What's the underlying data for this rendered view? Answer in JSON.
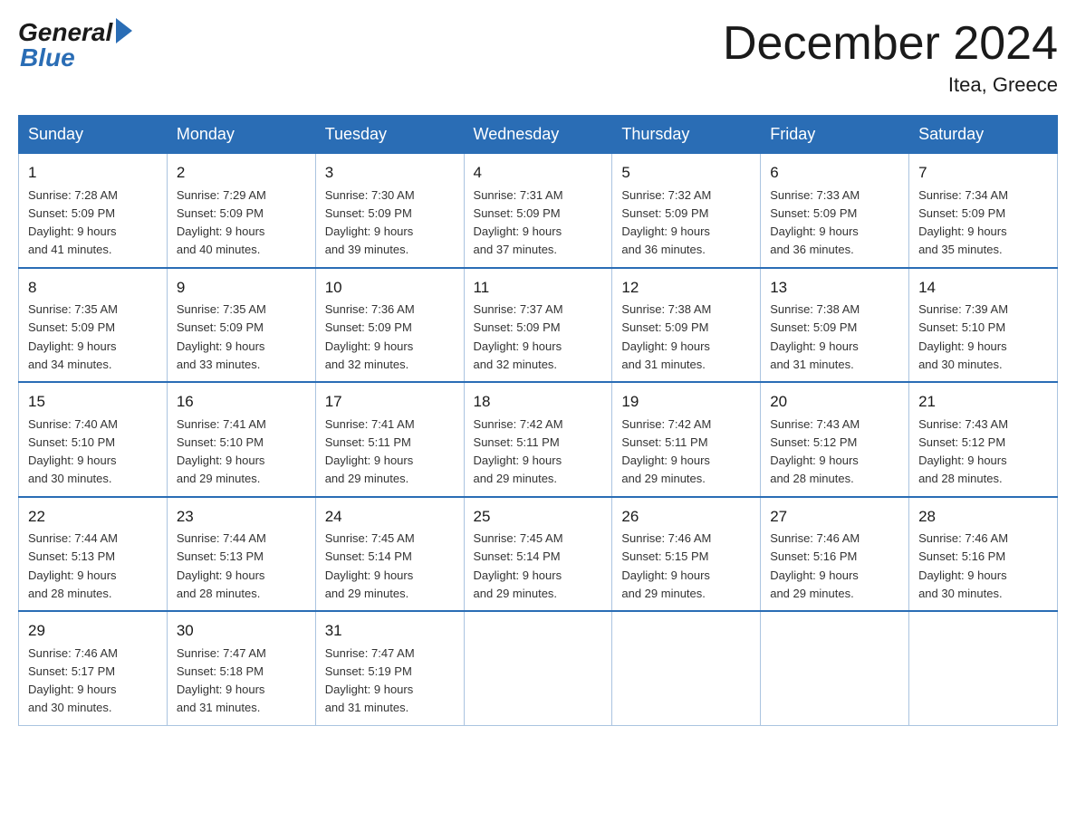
{
  "logo": {
    "general": "General",
    "blue": "Blue"
  },
  "title": "December 2024",
  "location": "Itea, Greece",
  "days_of_week": [
    "Sunday",
    "Monday",
    "Tuesday",
    "Wednesday",
    "Thursday",
    "Friday",
    "Saturday"
  ],
  "weeks": [
    [
      {
        "day": "1",
        "sunrise": "7:28 AM",
        "sunset": "5:09 PM",
        "daylight": "9 hours and 41 minutes."
      },
      {
        "day": "2",
        "sunrise": "7:29 AM",
        "sunset": "5:09 PM",
        "daylight": "9 hours and 40 minutes."
      },
      {
        "day": "3",
        "sunrise": "7:30 AM",
        "sunset": "5:09 PM",
        "daylight": "9 hours and 39 minutes."
      },
      {
        "day": "4",
        "sunrise": "7:31 AM",
        "sunset": "5:09 PM",
        "daylight": "9 hours and 37 minutes."
      },
      {
        "day": "5",
        "sunrise": "7:32 AM",
        "sunset": "5:09 PM",
        "daylight": "9 hours and 36 minutes."
      },
      {
        "day": "6",
        "sunrise": "7:33 AM",
        "sunset": "5:09 PM",
        "daylight": "9 hours and 36 minutes."
      },
      {
        "day": "7",
        "sunrise": "7:34 AM",
        "sunset": "5:09 PM",
        "daylight": "9 hours and 35 minutes."
      }
    ],
    [
      {
        "day": "8",
        "sunrise": "7:35 AM",
        "sunset": "5:09 PM",
        "daylight": "9 hours and 34 minutes."
      },
      {
        "day": "9",
        "sunrise": "7:35 AM",
        "sunset": "5:09 PM",
        "daylight": "9 hours and 33 minutes."
      },
      {
        "day": "10",
        "sunrise": "7:36 AM",
        "sunset": "5:09 PM",
        "daylight": "9 hours and 32 minutes."
      },
      {
        "day": "11",
        "sunrise": "7:37 AM",
        "sunset": "5:09 PM",
        "daylight": "9 hours and 32 minutes."
      },
      {
        "day": "12",
        "sunrise": "7:38 AM",
        "sunset": "5:09 PM",
        "daylight": "9 hours and 31 minutes."
      },
      {
        "day": "13",
        "sunrise": "7:38 AM",
        "sunset": "5:09 PM",
        "daylight": "9 hours and 31 minutes."
      },
      {
        "day": "14",
        "sunrise": "7:39 AM",
        "sunset": "5:10 PM",
        "daylight": "9 hours and 30 minutes."
      }
    ],
    [
      {
        "day": "15",
        "sunrise": "7:40 AM",
        "sunset": "5:10 PM",
        "daylight": "9 hours and 30 minutes."
      },
      {
        "day": "16",
        "sunrise": "7:41 AM",
        "sunset": "5:10 PM",
        "daylight": "9 hours and 29 minutes."
      },
      {
        "day": "17",
        "sunrise": "7:41 AM",
        "sunset": "5:11 PM",
        "daylight": "9 hours and 29 minutes."
      },
      {
        "day": "18",
        "sunrise": "7:42 AM",
        "sunset": "5:11 PM",
        "daylight": "9 hours and 29 minutes."
      },
      {
        "day": "19",
        "sunrise": "7:42 AM",
        "sunset": "5:11 PM",
        "daylight": "9 hours and 29 minutes."
      },
      {
        "day": "20",
        "sunrise": "7:43 AM",
        "sunset": "5:12 PM",
        "daylight": "9 hours and 28 minutes."
      },
      {
        "day": "21",
        "sunrise": "7:43 AM",
        "sunset": "5:12 PM",
        "daylight": "9 hours and 28 minutes."
      }
    ],
    [
      {
        "day": "22",
        "sunrise": "7:44 AM",
        "sunset": "5:13 PM",
        "daylight": "9 hours and 28 minutes."
      },
      {
        "day": "23",
        "sunrise": "7:44 AM",
        "sunset": "5:13 PM",
        "daylight": "9 hours and 28 minutes."
      },
      {
        "day": "24",
        "sunrise": "7:45 AM",
        "sunset": "5:14 PM",
        "daylight": "9 hours and 29 minutes."
      },
      {
        "day": "25",
        "sunrise": "7:45 AM",
        "sunset": "5:14 PM",
        "daylight": "9 hours and 29 minutes."
      },
      {
        "day": "26",
        "sunrise": "7:46 AM",
        "sunset": "5:15 PM",
        "daylight": "9 hours and 29 minutes."
      },
      {
        "day": "27",
        "sunrise": "7:46 AM",
        "sunset": "5:16 PM",
        "daylight": "9 hours and 29 minutes."
      },
      {
        "day": "28",
        "sunrise": "7:46 AM",
        "sunset": "5:16 PM",
        "daylight": "9 hours and 30 minutes."
      }
    ],
    [
      {
        "day": "29",
        "sunrise": "7:46 AM",
        "sunset": "5:17 PM",
        "daylight": "9 hours and 30 minutes."
      },
      {
        "day": "30",
        "sunrise": "7:47 AM",
        "sunset": "5:18 PM",
        "daylight": "9 hours and 31 minutes."
      },
      {
        "day": "31",
        "sunrise": "7:47 AM",
        "sunset": "5:19 PM",
        "daylight": "9 hours and 31 minutes."
      },
      null,
      null,
      null,
      null
    ]
  ],
  "labels": {
    "sunrise": "Sunrise:",
    "sunset": "Sunset:",
    "daylight": "Daylight:"
  }
}
